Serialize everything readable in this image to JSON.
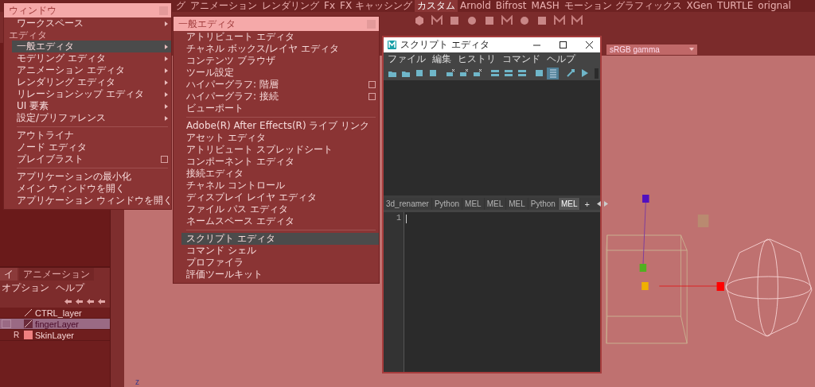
{
  "shelf": {
    "tabs": [
      {
        "label": "グ",
        "selected": false
      },
      {
        "label": "アニメーション",
        "selected": false
      },
      {
        "label": "レンダリング",
        "selected": false
      },
      {
        "label": "Fx",
        "selected": false
      },
      {
        "label": "FX キャッシング",
        "selected": false
      },
      {
        "label": "カスタム",
        "selected": true
      },
      {
        "label": "Arnold",
        "selected": false
      },
      {
        "label": "Bifrost",
        "selected": false
      },
      {
        "label": "MASH",
        "selected": false
      },
      {
        "label": "モーション グラフィックス",
        "selected": false
      },
      {
        "label": "XGen",
        "selected": false
      },
      {
        "label": "TURTLE",
        "selected": false
      },
      {
        "label": "orignal",
        "selected": false
      }
    ]
  },
  "window_menu": {
    "title": "ウィンドウ",
    "items": [
      {
        "kind": "item",
        "label": "ワークスペース",
        "submenu": true,
        "selected": false
      },
      {
        "kind": "section",
        "label": "エディタ"
      },
      {
        "kind": "item",
        "label": "一般エディタ",
        "submenu": true,
        "selected": true
      },
      {
        "kind": "item",
        "label": "モデリング エディタ",
        "submenu": true,
        "selected": false
      },
      {
        "kind": "item",
        "label": "アニメーション エディタ",
        "submenu": true,
        "selected": false
      },
      {
        "kind": "item",
        "label": "レンダリング エディタ",
        "submenu": true,
        "selected": false
      },
      {
        "kind": "item",
        "label": "リレーションシップ エディタ",
        "submenu": true,
        "selected": false
      },
      {
        "kind": "item",
        "label": "UI 要素",
        "submenu": true,
        "selected": false
      },
      {
        "kind": "item",
        "label": "設定/プリファレンス",
        "submenu": true,
        "selected": false
      },
      {
        "kind": "separator"
      },
      {
        "kind": "item",
        "label": "アウトライナ",
        "submenu": false,
        "selected": false
      },
      {
        "kind": "item",
        "label": "ノード エディタ",
        "submenu": false,
        "selected": false
      },
      {
        "kind": "checkbox",
        "label": "プレイブラスト",
        "checked": false,
        "selected": false
      },
      {
        "kind": "separator"
      },
      {
        "kind": "item",
        "label": "アプリケーションの最小化",
        "submenu": false,
        "selected": false
      },
      {
        "kind": "item",
        "label": "メイン ウィンドウを開く",
        "submenu": false,
        "selected": false
      },
      {
        "kind": "item",
        "label": "アプリケーション ウィンドウを開く",
        "submenu": false,
        "selected": false
      }
    ]
  },
  "general_editors_menu": {
    "title": "一般エディタ",
    "items": [
      {
        "kind": "item",
        "label": "アトリビュート エディタ",
        "submenu": false,
        "selected": false
      },
      {
        "kind": "item",
        "label": "チャネル ボックス/レイヤ エディタ",
        "submenu": false,
        "selected": false
      },
      {
        "kind": "item",
        "label": "コンテンツ ブラウザ",
        "submenu": false,
        "selected": false
      },
      {
        "kind": "item",
        "label": "ツール設定",
        "submenu": false,
        "selected": false
      },
      {
        "kind": "checkbox",
        "label": "ハイパーグラフ: 階層",
        "checked": false,
        "selected": false
      },
      {
        "kind": "checkbox",
        "label": "ハイパーグラフ: 接続",
        "checked": false,
        "selected": false
      },
      {
        "kind": "item",
        "label": "ビューポート",
        "submenu": false,
        "selected": false
      },
      {
        "kind": "separator"
      },
      {
        "kind": "item",
        "label": "Adobe(R) After Effects(R) ライブ リンク",
        "submenu": false,
        "selected": false
      },
      {
        "kind": "item",
        "label": "アセット エディタ",
        "submenu": false,
        "selected": false
      },
      {
        "kind": "item",
        "label": "アトリビュート スプレッドシート",
        "submenu": false,
        "selected": false
      },
      {
        "kind": "item",
        "label": "コンポーネント エディタ",
        "submenu": false,
        "selected": false
      },
      {
        "kind": "item",
        "label": "接続エディタ",
        "submenu": false,
        "selected": false
      },
      {
        "kind": "item",
        "label": "チャネル コントロール",
        "submenu": false,
        "selected": false
      },
      {
        "kind": "item",
        "label": "ディスプレイ レイヤ エディタ",
        "submenu": false,
        "selected": false
      },
      {
        "kind": "item",
        "label": "ファイル パス エディタ",
        "submenu": false,
        "selected": false
      },
      {
        "kind": "item",
        "label": "ネームスペース エディタ",
        "submenu": false,
        "selected": false
      },
      {
        "kind": "separator"
      },
      {
        "kind": "item",
        "label": "スクリプト エディタ",
        "submenu": false,
        "selected": true
      },
      {
        "kind": "item",
        "label": "コマンド シェル",
        "submenu": false,
        "selected": false
      },
      {
        "kind": "item",
        "label": "プロファイラ",
        "submenu": false,
        "selected": false
      },
      {
        "kind": "item",
        "label": "評価ツールキット",
        "submenu": false,
        "selected": false
      }
    ]
  },
  "viewport": {
    "color_space": "sRGB gamma",
    "axis_label": "z"
  },
  "layer_editor": {
    "tabs": [
      {
        "label": "イ",
        "selected": true
      },
      {
        "label": "アニメーション",
        "selected": false
      }
    ],
    "menu": [
      "オプション",
      "ヘルプ"
    ],
    "rows": [
      {
        "name": "CTRL_layer",
        "selected": false
      },
      {
        "name": "fingerLayer",
        "selected": true
      },
      {
        "name": "SkinLayer",
        "selected": false,
        "mode": "R",
        "color": "#ef8080"
      }
    ]
  },
  "script_editor": {
    "title": "スクリプト エディタ",
    "menu": [
      "ファイル",
      "編集",
      "ヒストリ",
      "コマンド",
      "ヘルプ"
    ],
    "toolbar": [
      {
        "on": false
      },
      {
        "on": false
      },
      {
        "on": false
      },
      {
        "on": false
      },
      {
        "on": false
      },
      {
        "on": false
      },
      {
        "on": false
      },
      {
        "on": false
      },
      {
        "on": false
      },
      {
        "on": false
      },
      {
        "on": false
      },
      {
        "on": true
      },
      {
        "on": false
      },
      {
        "on": false
      }
    ],
    "tabs": [
      {
        "label": "3d_renamer",
        "selected": false
      },
      {
        "label": "Python",
        "selected": false
      },
      {
        "label": "MEL",
        "selected": false
      },
      {
        "label": "MEL",
        "selected": false
      },
      {
        "label": "MEL",
        "selected": false
      },
      {
        "label": "Python",
        "selected": false
      },
      {
        "label": "MEL",
        "selected": true
      }
    ],
    "add_tab": "+",
    "line_numbers": [
      "1"
    ]
  }
}
